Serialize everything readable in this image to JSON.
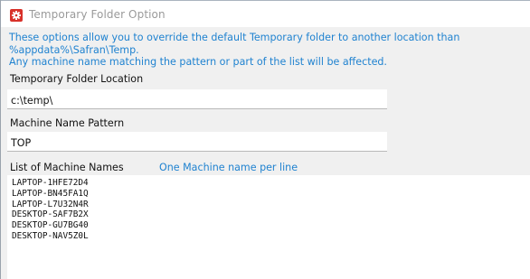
{
  "window": {
    "title": "Temporary Folder Option",
    "icon": "gear-icon"
  },
  "description": "These options allow you to override the default Temporary folder to another location than %appdata%\\Safran\\Temp.\nAny machine name matching the pattern or part of the list will be affected.",
  "folder": {
    "label": "Temporary Folder Location",
    "value": "c:\\temp\\"
  },
  "pattern": {
    "label": "Machine Name Pattern",
    "value": "TOP"
  },
  "machines": {
    "label": "List of Machine Names",
    "hint": "One Machine name per line",
    "items": [
      "LAPTOP-1HFE72D4",
      "LAPTOP-BN45FA1Q",
      "LAPTOP-L7U32N4R",
      "DESKTOP-SAF7B2X",
      "DESKTOP-GU7BG40",
      "DESKTOP-NAV5Z0L"
    ]
  },
  "colors": {
    "accent": "#1f82d0",
    "icon_background": "#d8312a",
    "title_text": "#9a9a9a",
    "panel_background": "#f0f0f0"
  }
}
